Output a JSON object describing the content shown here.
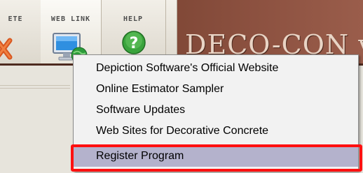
{
  "toolbar": {
    "delete_label": "ETE",
    "weblink_label": "WEB LINK",
    "help_label": "HELP"
  },
  "brand": {
    "title": "DECO-CON v"
  },
  "menu": {
    "items": [
      {
        "label": "Depiction Software's Official Website"
      },
      {
        "label": "Online Estimator Sampler"
      },
      {
        "label": "Software Updates"
      },
      {
        "label": "Web Sites for Decorative Concrete"
      },
      {
        "label": "Register Program"
      }
    ],
    "selected_index": 4
  },
  "colors": {
    "header_brown": "#7a4332",
    "menu_background": "#f2f2f2",
    "selection": "#b4b2cc",
    "highlight_box": "#ff1010"
  },
  "icons": [
    "delete-x-icon",
    "computer-globe-icon",
    "help-question-icon"
  ]
}
